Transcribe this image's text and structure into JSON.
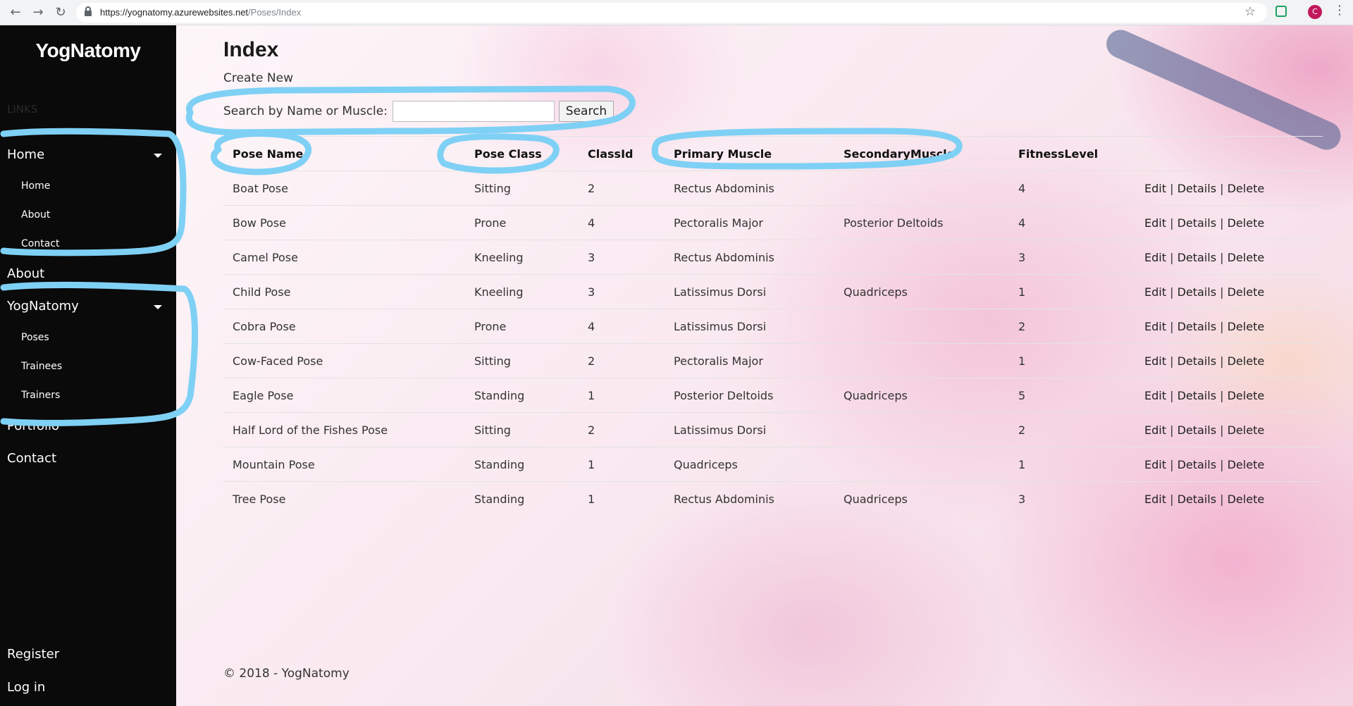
{
  "browser": {
    "url_host": "https://yognatomy.azurewebsites.net",
    "url_path": "/Poses/Index",
    "avatar_letter": "C"
  },
  "sidebar": {
    "brand": "YogNatomy",
    "links_label": "LINKS",
    "home": "Home",
    "home_sub": [
      "Home",
      "About",
      "Contact"
    ],
    "about": "About",
    "yognatomy": "YogNatomy",
    "yognatomy_sub": [
      "Poses",
      "Trainees",
      "Trainers"
    ],
    "portfolio": "Portfolio",
    "contact": "Contact",
    "register": "Register",
    "login": "Log in"
  },
  "main": {
    "title": "Index",
    "create_new": "Create New",
    "search_label": "Search by Name or Muscle:",
    "search_value": "",
    "search_button": "Search",
    "columns": [
      "Pose Name",
      "Pose Class",
      "ClassId",
      "Primary Muscle",
      "SecondaryMuscle",
      "FitnessLevel"
    ],
    "actions": {
      "edit": "Edit",
      "details": "Details",
      "delete": "Delete",
      "sep": "|"
    },
    "rows": [
      [
        "Boat Pose",
        "Sitting",
        "2",
        "Rectus Abdominis",
        "",
        "4"
      ],
      [
        "Bow Pose",
        "Prone",
        "4",
        "Pectoralis Major",
        "Posterior Deltoids",
        "4"
      ],
      [
        "Camel Pose",
        "Kneeling",
        "3",
        "Rectus Abdominis",
        "",
        "3"
      ],
      [
        "Child Pose",
        "Kneeling",
        "3",
        "Latissimus Dorsi",
        "Quadriceps",
        "1"
      ],
      [
        "Cobra Pose",
        "Prone",
        "4",
        "Latissimus Dorsi",
        "",
        "2"
      ],
      [
        "Cow-Faced Pose",
        "Sitting",
        "2",
        "Pectoralis Major",
        "",
        "1"
      ],
      [
        "Eagle Pose",
        "Standing",
        "1",
        "Posterior Deltoids",
        "Quadriceps",
        "5"
      ],
      [
        "Half Lord of the Fishes Pose",
        "Sitting",
        "2",
        "Latissimus Dorsi",
        "",
        "2"
      ],
      [
        "Mountain Pose",
        "Standing",
        "1",
        "Quadriceps",
        "",
        "1"
      ],
      [
        "Tree Pose",
        "Standing",
        "1",
        "Rectus Abdominis",
        "Quadriceps",
        "3"
      ]
    ],
    "footer": "© 2018 - YogNatomy"
  },
  "colors": {
    "sidebar_bg": "#0a0a0a",
    "highlight": "#7fd0f5"
  }
}
